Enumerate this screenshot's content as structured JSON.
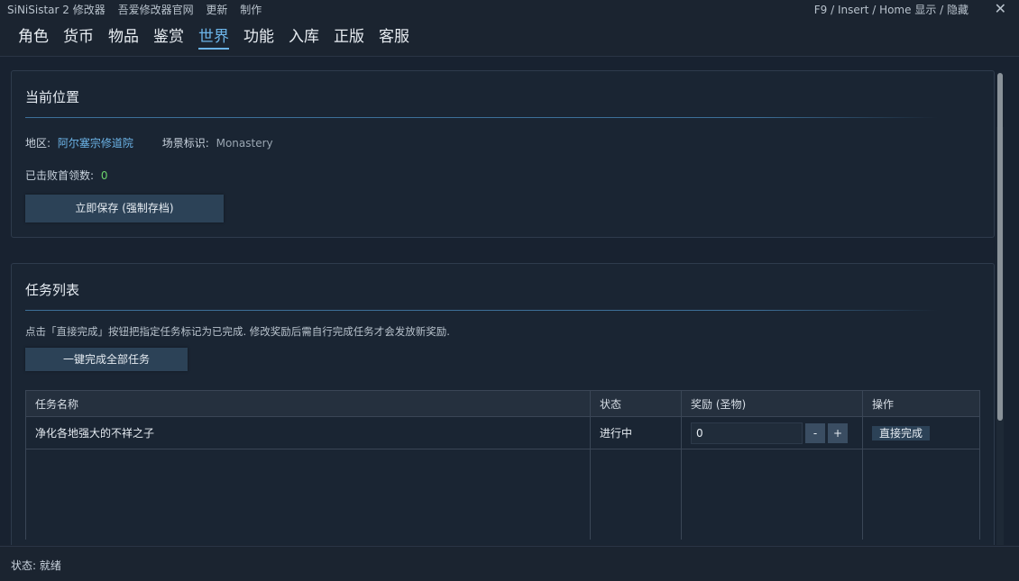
{
  "titlebar": {
    "app_name": "SiNiSistar 2 修改器",
    "link_official": "吾爱修改器官网",
    "link_update": "更新",
    "link_credits": "制作",
    "hotkey_hint": "F9 / Insert / Home  显示 / 隐藏",
    "close_glyph": "✕"
  },
  "nav": {
    "tabs": [
      "角色",
      "货币",
      "物品",
      "鉴赏",
      "世界",
      "功能",
      "入库",
      "正版",
      "客服"
    ],
    "active": "世界"
  },
  "location": {
    "title": "当前位置",
    "region_label": "地区:",
    "region_value": "阿尔塞宗修道院",
    "scene_label": "场景标识:",
    "scene_value": "Monastery",
    "bosses_label": "已击败首领数:",
    "bosses_value": "0",
    "save_button": "立即保存 (强制存档)"
  },
  "tasks": {
    "title": "任务列表",
    "description": "点击「直接完成」按钮把指定任务标记为已完成. 修改奖励后需自行完成任务才会发放新奖励.",
    "complete_all_button": "一键完成全部任务",
    "columns": [
      "任务名称",
      "状态",
      "奖励 (圣物)",
      "操作"
    ],
    "rows": [
      {
        "name": "净化各地强大的不祥之子",
        "status": "进行中",
        "reward": "0",
        "minus": "-",
        "plus": "+",
        "action": "直接完成"
      }
    ]
  },
  "status_bar": {
    "text": "状态: 就绪"
  },
  "colors": {
    "accent": "#6cb4e8",
    "status_running": "#e6a33a",
    "bosses_value": "#6bd36b"
  }
}
